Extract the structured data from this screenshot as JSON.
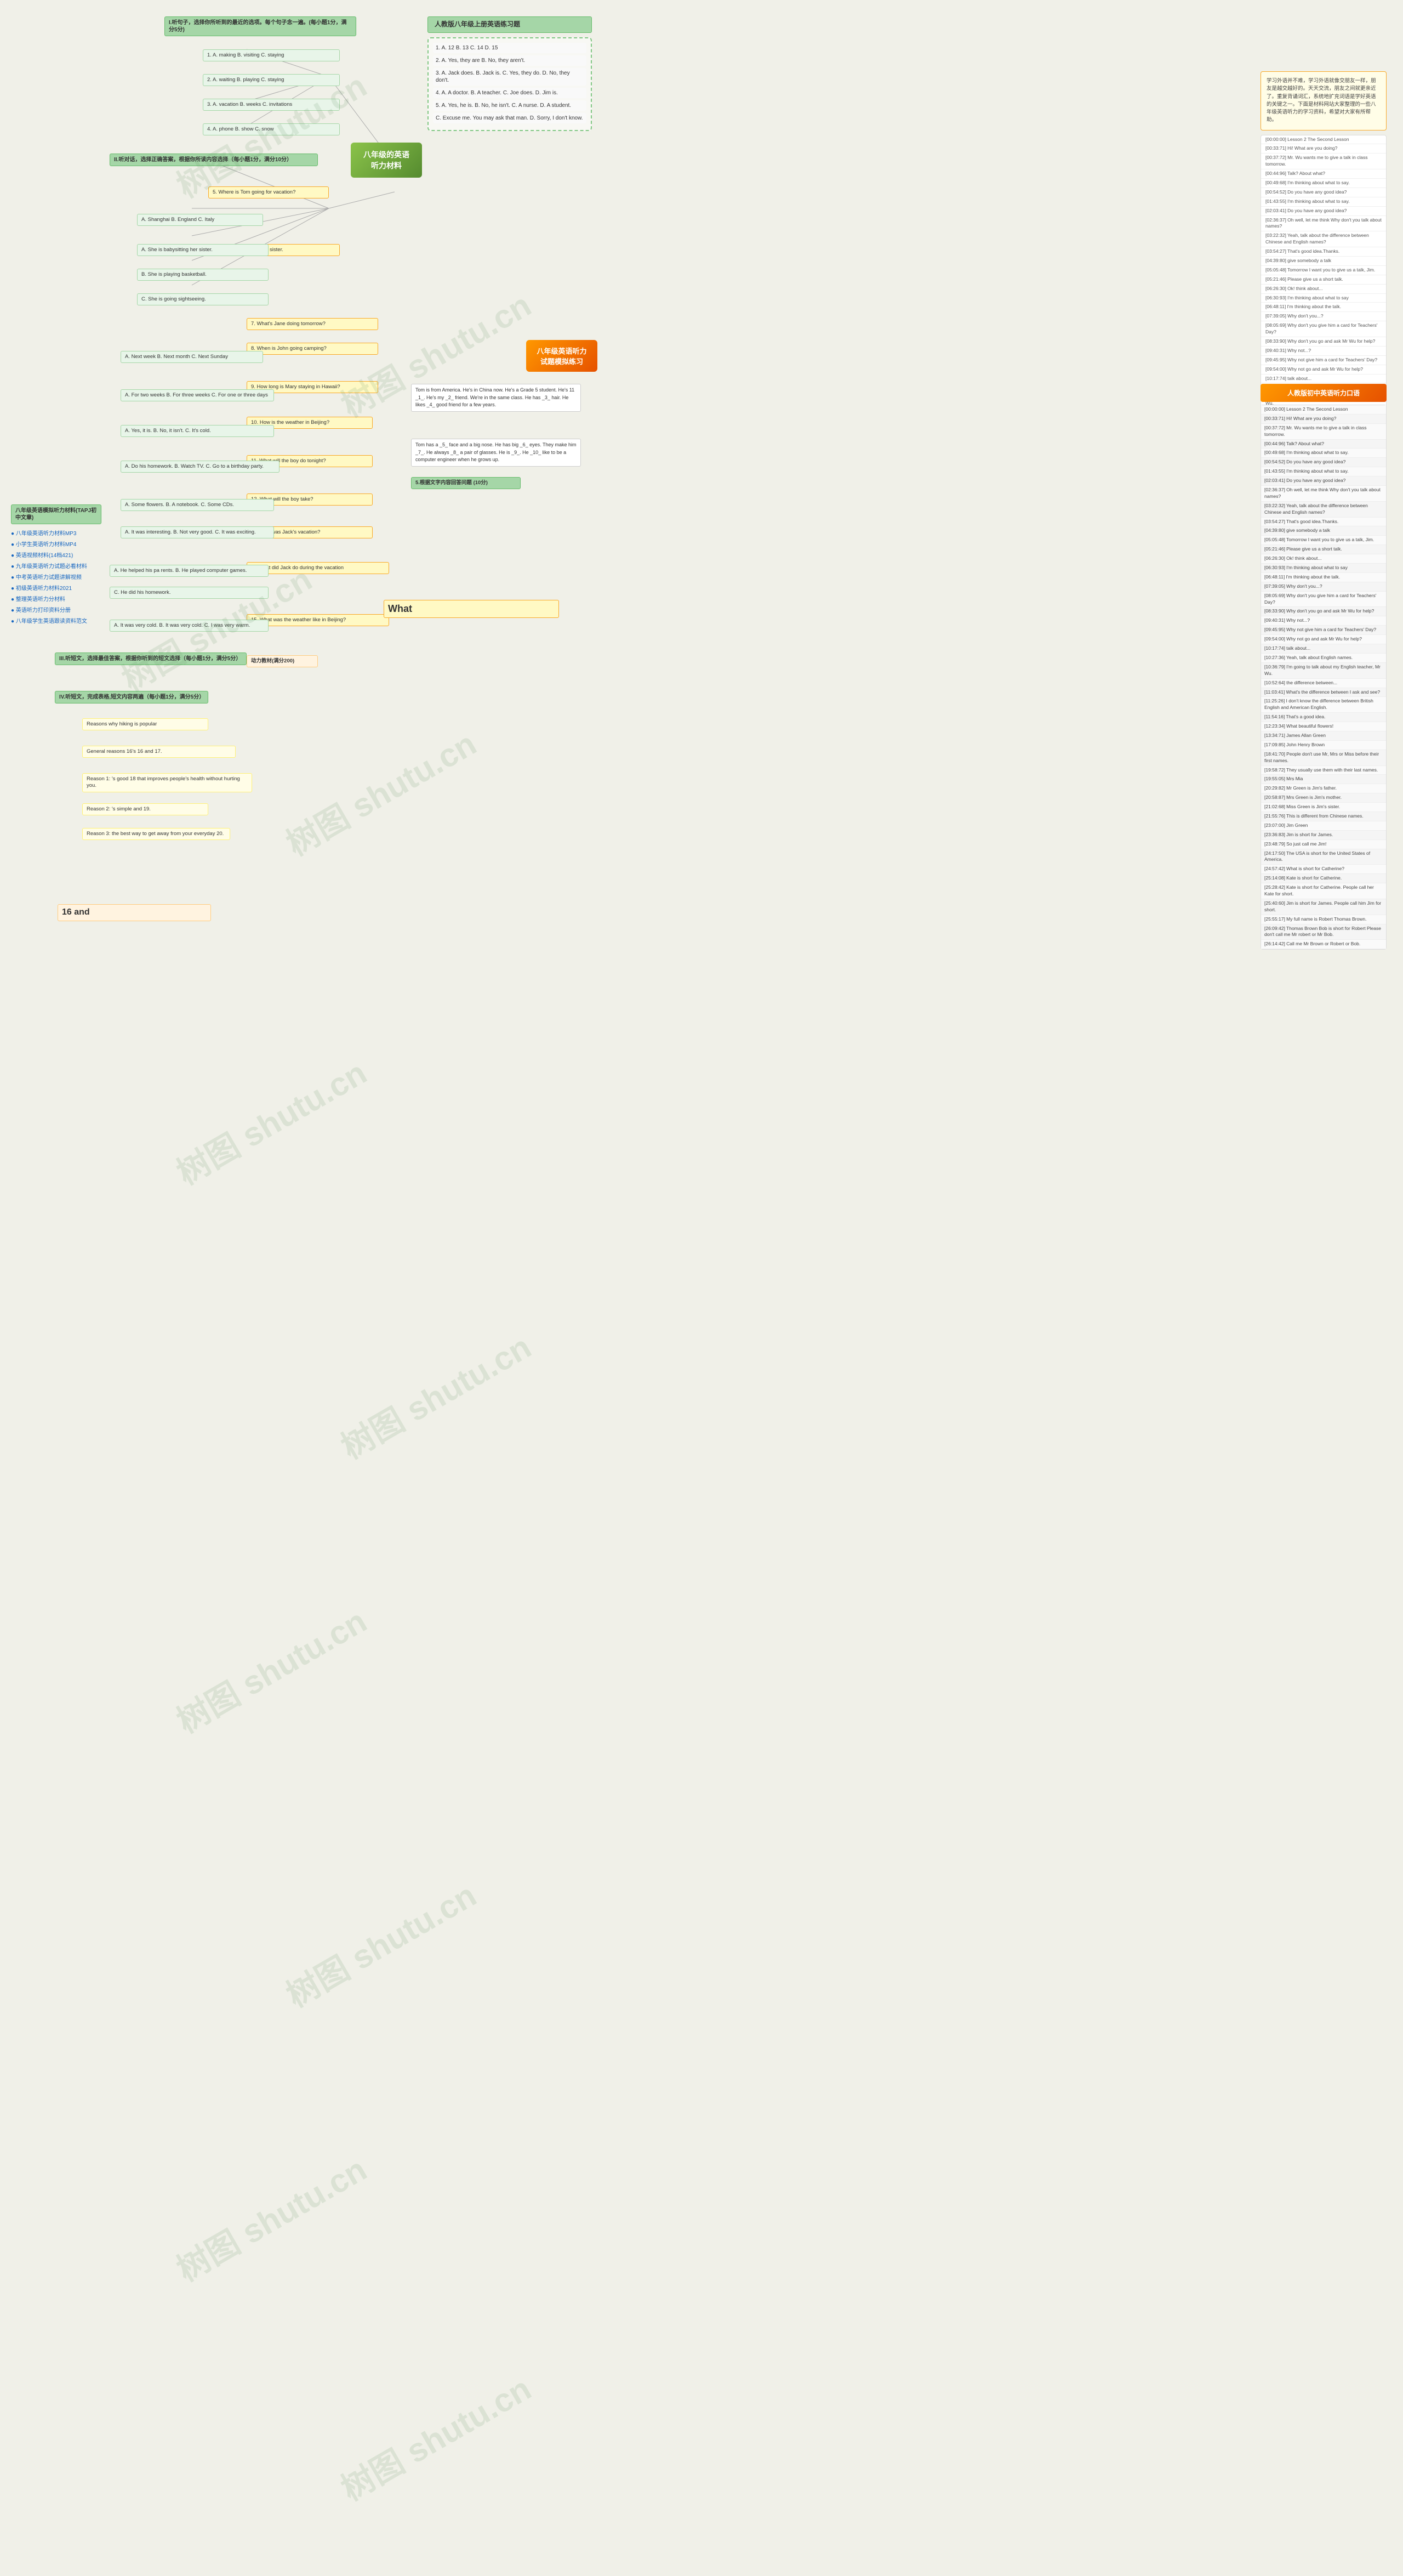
{
  "site": {
    "watermark": "树图 shupu.cn",
    "title": "八年级的英语听力材料",
    "title2": "八年级英语听力试题模拟练习"
  },
  "central_node": {
    "label": "八年级的英语听力材料"
  },
  "central_node2": {
    "label": "八年级英语听力试题模拟练习"
  },
  "section1": {
    "header": "I.听句子，选择你所听到的最近的选项。每个句子念一遍。(每小题1分，满分5分)",
    "items": [
      "1. A. making  B. visiting C. staying",
      "2. A. waiting B. playing C. staying",
      "3. A. vacation B. weeks C. invitations",
      "4. A. phone B. show C. snow"
    ]
  },
  "section2": {
    "header": "II.听对话，选择正确答案，根据你所读内容选择（每小题1分，满分10分）",
    "items": [
      "5. Where is Tom going for vacation?",
      "6. She is babysitting her sister.",
      "7. What's Jane doing tomorrow?",
      "8. When is John going camping?",
      "9. How long is Mary staying in Hawaii?"
    ]
  },
  "section2_answers": [
    "A. Shanghai B. England C. Italy",
    "A. She is babysitting her sister.",
    "B. She is playing basketball.",
    "C. She is going sightseeing.",
    "A. Next week B. Next month C. Next Sunday",
    "A. For two weeks B. For three weeks C. For one or three days"
  ],
  "questions": {
    "q10": "10. How is the weather in Beijing?",
    "q11": "11. What will the boy do tonight?",
    "q12": "12. What will the boy take?",
    "q13": "13. How was Jack's vacation?",
    "q14": "14.What did Jack do during the vacation",
    "q15": "15. What was the weather like in Beijing?"
  },
  "q10_opts": "A. Yes, it is. B. No, it isn't. C. It's cold.",
  "q11_opts": "A. Do his homework. B. Watch TV. C. Go to a birthday party.",
  "q12_opts": "A. Some flowers. B. A notebook. C. Some CDs.",
  "q13_opts": "A. It was interesting. B. Not very good. C. It was exciting.",
  "q14_items": [
    "A. He helped his pa rents. B. He played computer games.",
    "C. He did his homework."
  ],
  "q15_opts": "A. It was very cold. B. It was very cold. C. I was very warm.",
  "section3": {
    "header": "III.听短文，选择最佳答案，根据你听到的短文选择（每小题1分，满分5分）",
    "note": "动力教材(满分200)"
  },
  "section4": {
    "header": "IV.听短文，完成表格,短文内容两遍（每小题1分，满分5分）",
    "items": [
      "Reasons why hiking is popular",
      "General reasons 16's 16 and 17.",
      "Reason 1: 's good 18 that improves people's health without hurting you.",
      "Reason 2: 's simple and 19.",
      "Reason 3: the best way to get away from your everyday 20."
    ]
  },
  "answers_section": {
    "header": "人教版八年级上册英语练习题",
    "answers": [
      "1. A. 12 B. 13 C. 14 D. 15",
      "2. A. Yes, they are B. No, they aren't.",
      "3. A. Jack does. B. Jack is. C. Yes, they do. D. No, they don't.",
      "4. A. A doctor. B. A teacher. C. Joe does. D. Jim is.",
      "5. A. Yes, he is. B. No, he isn't. C. A nurse. D. A student.",
      "C. Excuse me. You may ask that man. D. Sorry, I don't know."
    ]
  },
  "passage": {
    "text1": "Tom is from America. He's in China now. He's a Grade 5 student. He's 11 _1_. He's my _2_ friend. We're in the same class. He has _3_ hair. He likes _4_ good friend for a few years.",
    "text2": "Tom has a _5_ face and a big nose. He has big _6_ eyes. They make him _7_. He always _8_ a pair of glasses. He is _9_. He _10_ like to be a computer engineer when he grows up."
  },
  "section5": {
    "header": "5.根据文字内容回答问题 (10分)"
  },
  "sidebar_links": [
    "八年级英语听力材料MP3",
    "小学生英语听力材料MP4",
    "英语视频材料(14档421)",
    "九年级英语听力试题必看材料",
    "中考英语听力试题讲解视频",
    "初级英语听力材料2021",
    "整理英语听力分材料",
    "英语听力打印资料分册",
    "八年级学生英语跟读资料范文"
  ],
  "left_box_header": "八年级英语模拟听力材料(TAPJ初中文章)",
  "right_panel_intro": "学习外语并不难，学习外语就像交朋友一样，朋友是越交越好的。天天交流，朋友之间就更亲近了。重复背诵词汇，系统地扩充词语是学好英语的关键之一。下面是材料网站大家整理的一些八年级英语听力的学习资料，希望对大家有所帮助。",
  "right_panel_items": [
    "[00:00:00] Lesson 2 The Second Lesson",
    "[00:33:71] Hi! What are you doing?",
    "[00:37:72] Mr. Wu wants me to give a talk in class tomorrow.",
    "[00:44:96] Talk? About what?",
    "[00:49:68] I'm thinking about what to say.",
    "[00:54:52] Do you have any good idea?",
    "[01:43:55] I'm thinking about what to say.",
    "[02:03:41] Do you have any good idea?",
    "[02:36:37] Oh well, let me think Why don't you talk about names?",
    "[03:22:32] Yeah, talk about the difference between Chinese and English names?",
    "[03:54:27] That's good idea.Thanks.",
    "[04:39:80] give somebody a talk",
    "[05:05:48] Tomorrow I want you to give us a talk, Jim.",
    "[05:21:46] Please give us a short talk.",
    "[06:26:30] Ok! think about...",
    "[06:30:93] I'm thinking about what to say",
    "[06:48:11] I'm thinking about the talk.",
    "[07:39:05] Why don't you...?",
    "[08:05:69] Why don't you give him a card for Teachers' Day?",
    "[08:33:90] Why don't you go and ask Mr Wu for help?",
    "[09:40:31] Why not...?",
    "[09:45:95] Why not give him a card for Teachers' Day?",
    "[09:54:00] Why not go and ask Mr Wu for help?",
    "[10:17:74] talk about...",
    "[10:27:36] Yeah, talk about English names.",
    "[10:36:79] I'm going to talk about my English teacher, Mr Wu.",
    "[10:52:64] the difference between...",
    "[11:03:41] What's the difference between I ask and see?",
    "[11:25:26] I don't know the difference between British English and American English.",
    "[11:54:16] That's a good idea.",
    "[12:23:34] What beautiful flowers!",
    "[13:34:71] James Allan Green",
    "[17:09:85] John Henry Brown",
    "[18:41:70] People don't use Mr, Mrs or Miss before their first names.",
    "[19:58:72] They usually use them with their last names.",
    "[19:55:05] Mrs Mia",
    "[20:29:82] Mr Green is Jim's father.",
    "[20:58:87] Mrs Green is Jim's mother.",
    "[21:02:68] Miss Green is Jim's sister.",
    "[21:55:76] This is different from Chinese names.",
    "[23:07:00] Jim Green",
    "[23:36:83] Jim is short for James.",
    "[23:48:79] So just call me Jim!",
    "[24:17:50] The USA is short for the United States of America.",
    "[24:57:42] What is short for Catherine?",
    "[25:14:08] Kate is short for Catherine.",
    "[25:28:42] Kate is short for Catherine. People call her Kate for short.",
    "[25:40:60] Jim is short for James. People call him Jim for short.",
    "[25:55:17] My full name is Robert Thomas Brown.",
    "[26:09:42] Thomas Brown Bob is short for Robert Please don't call me Mr robert or Mr Bob.",
    "[26:14:42] Call me Mr Brown or Robert or Bob."
  ],
  "transcript_header": "人教版初中英语听力口语",
  "practice_answers": {
    "header": "人教版八年级上册英语练习题",
    "q16": "16 and",
    "q_what": "What"
  }
}
